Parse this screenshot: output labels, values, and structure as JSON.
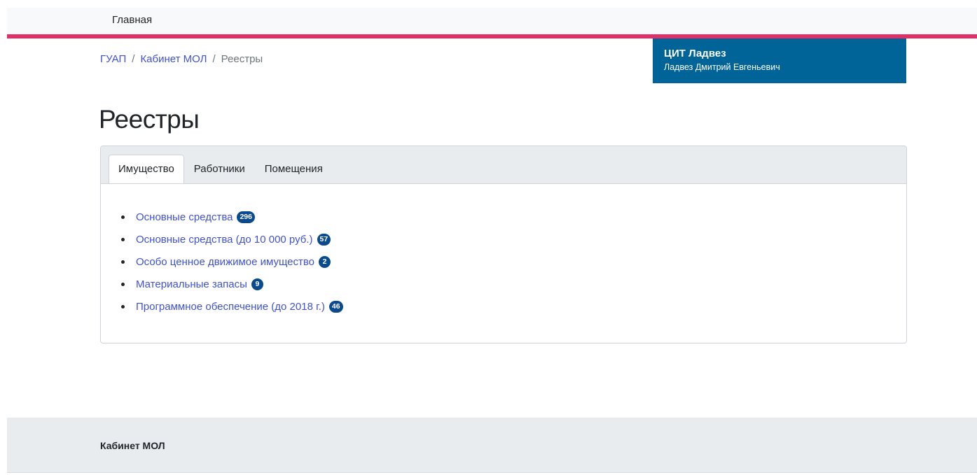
{
  "nav": {
    "home_label": "Главная"
  },
  "breadcrumb": {
    "items": [
      "ГУАП",
      "Кабинет МОЛ",
      "Реестры"
    ],
    "separator": "/"
  },
  "user": {
    "org": "ЦИТ Ладвез",
    "name": "Ладвез Дмитрий Евгеньевич"
  },
  "page": {
    "title": "Реестры"
  },
  "tabs": [
    {
      "label": "Имущество",
      "active": true
    },
    {
      "label": "Работники",
      "active": false
    },
    {
      "label": "Помещения",
      "active": false
    }
  ],
  "registers": [
    {
      "label": "Основные средства",
      "count": "296"
    },
    {
      "label": "Основные средства (до 10 000 руб.)",
      "count": "57"
    },
    {
      "label": "Особо ценное движимое имущество",
      "count": "2"
    },
    {
      "label": "Материальные запасы",
      "count": "9"
    },
    {
      "label": "Программное обеспечение (до 2018 г.)",
      "count": "46"
    }
  ],
  "footer": {
    "title": "Кабинет МОЛ"
  },
  "colors": {
    "accent_line": "#e0306a",
    "user_box": "#006498",
    "badge": "#0b4a8f",
    "link": "#3f51d8"
  }
}
